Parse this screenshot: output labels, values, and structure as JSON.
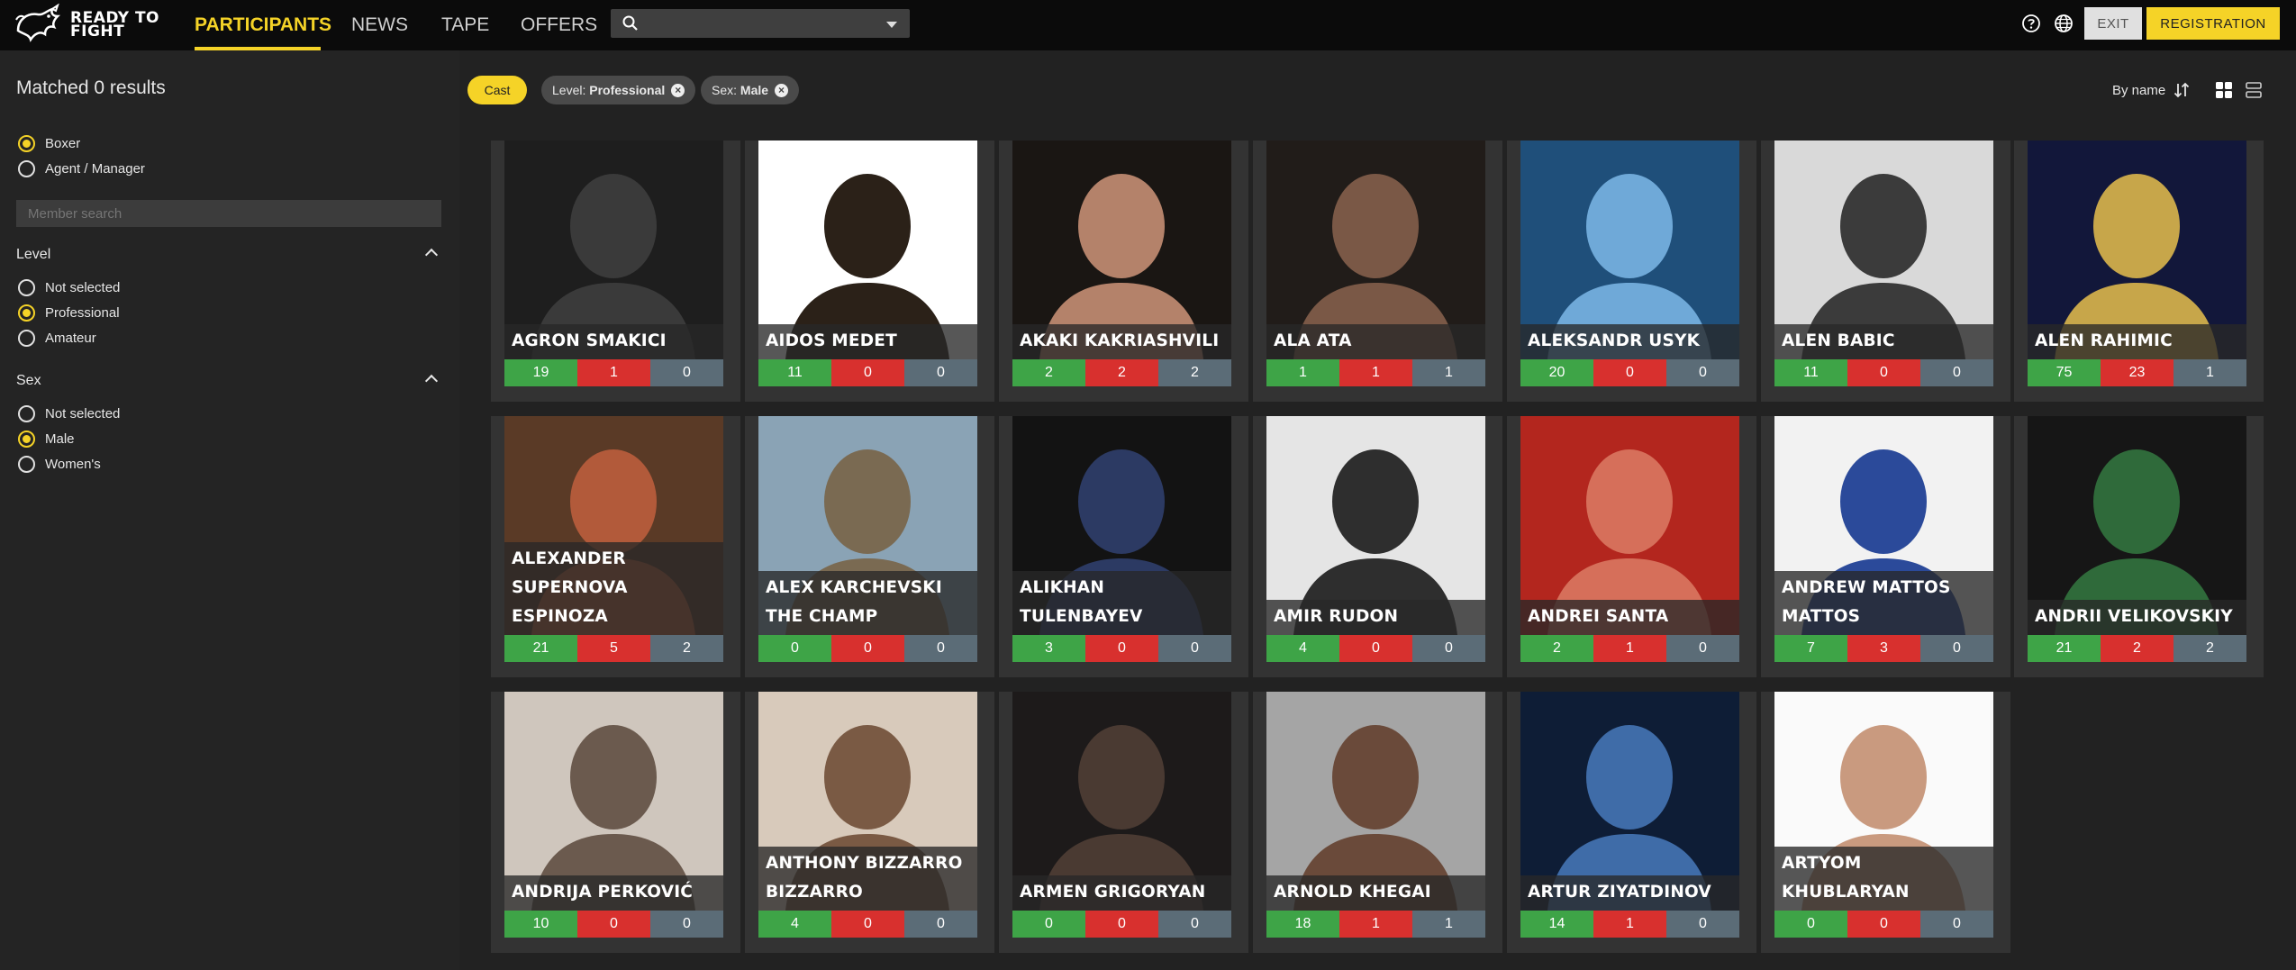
{
  "brand": {
    "line1": "READY TO",
    "line2": "FIGHT"
  },
  "nav": [
    {
      "label": "PARTICIPANTS",
      "active": true
    },
    {
      "label": "NEWS",
      "active": false
    },
    {
      "label": "TAPE",
      "active": false
    },
    {
      "label": "OFFERS",
      "active": false
    }
  ],
  "search": {
    "placeholder": "",
    "value": ""
  },
  "header": {
    "exit_label": "EXIT",
    "registration_label": "REGISTRATION",
    "help_icon": "help-icon",
    "language_icon": "globe-icon"
  },
  "sidebar": {
    "matched": "Matched 0 results",
    "roles": [
      {
        "label": "Boxer",
        "selected": true
      },
      {
        "label": "Agent / Manager",
        "selected": false
      }
    ],
    "member_search_placeholder": "Member search",
    "level": {
      "title": "Level",
      "options": [
        {
          "label": "Not selected",
          "selected": false
        },
        {
          "label": "Professional",
          "selected": true
        },
        {
          "label": "Amateur",
          "selected": false
        }
      ]
    },
    "sex": {
      "title": "Sex",
      "options": [
        {
          "label": "Not selected",
          "selected": false
        },
        {
          "label": "Male",
          "selected": true
        },
        {
          "label": "Women's",
          "selected": false
        }
      ]
    }
  },
  "filters": {
    "cast_label": "Cast",
    "chips": [
      {
        "key": "Level:",
        "value": "Professional"
      },
      {
        "key": "Sex:",
        "value": "Male"
      }
    ],
    "sort_label": "By name"
  },
  "colors": {
    "accent": "#f5d327",
    "win": "#3ea447",
    "loss": "#d8302e",
    "draw": "#5b6c77"
  },
  "participants": [
    {
      "name": "AGRON SMAKICI",
      "wins": "19",
      "losses": "1",
      "draws": "0"
    },
    {
      "name": "AIDOS MEDET",
      "wins": "11",
      "losses": "0",
      "draws": "0"
    },
    {
      "name": "AKAKI KAKRIASHVILI",
      "wins": "2",
      "losses": "2",
      "draws": "2"
    },
    {
      "name": "ALA ATA",
      "wins": "1",
      "losses": "1",
      "draws": "1"
    },
    {
      "name": "ALEKSANDR USYK",
      "wins": "20",
      "losses": "0",
      "draws": "0"
    },
    {
      "name": "ALEN BABIC",
      "wins": "11",
      "losses": "0",
      "draws": "0"
    },
    {
      "name": "ALEN RAHIMIC",
      "wins": "75",
      "losses": "23",
      "draws": "1"
    },
    {
      "name": "ALEXANDER SUPERNOVA ESPINOZA",
      "wins": "21",
      "losses": "5",
      "draws": "2"
    },
    {
      "name": "ALEX KARCHEVSKI THE CHAMP",
      "wins": "0",
      "losses": "0",
      "draws": "0"
    },
    {
      "name": "ALIKHAN TULENBAYEV",
      "wins": "3",
      "losses": "0",
      "draws": "0"
    },
    {
      "name": "AMIR RUDON",
      "wins": "4",
      "losses": "0",
      "draws": "0"
    },
    {
      "name": "ANDREI SANTA",
      "wins": "2",
      "losses": "1",
      "draws": "0"
    },
    {
      "name": "ANDREW MATTOS MATTOS",
      "wins": "7",
      "losses": "3",
      "draws": "0"
    },
    {
      "name": "ANDRII VELIKOVSKIY",
      "wins": "21",
      "losses": "2",
      "draws": "2"
    },
    {
      "name": "ANDRIJA PERKOVIĆ",
      "wins": "10",
      "losses": "0",
      "draws": "0"
    },
    {
      "name": "ANTHONY BIZZARRO BIZZARRO",
      "wins": "4",
      "losses": "0",
      "draws": "0"
    },
    {
      "name": "ARMEN GRIGORYAN",
      "wins": "0",
      "losses": "0",
      "draws": "0"
    },
    {
      "name": "ARNOLD KHEGAI",
      "wins": "18",
      "losses": "1",
      "draws": "1"
    },
    {
      "name": "ARTUR ZIYATDINOV",
      "wins": "14",
      "losses": "1",
      "draws": "0"
    },
    {
      "name": "ARTYOM KHUBLARYAN",
      "wins": "0",
      "losses": "0",
      "draws": "0"
    }
  ]
}
